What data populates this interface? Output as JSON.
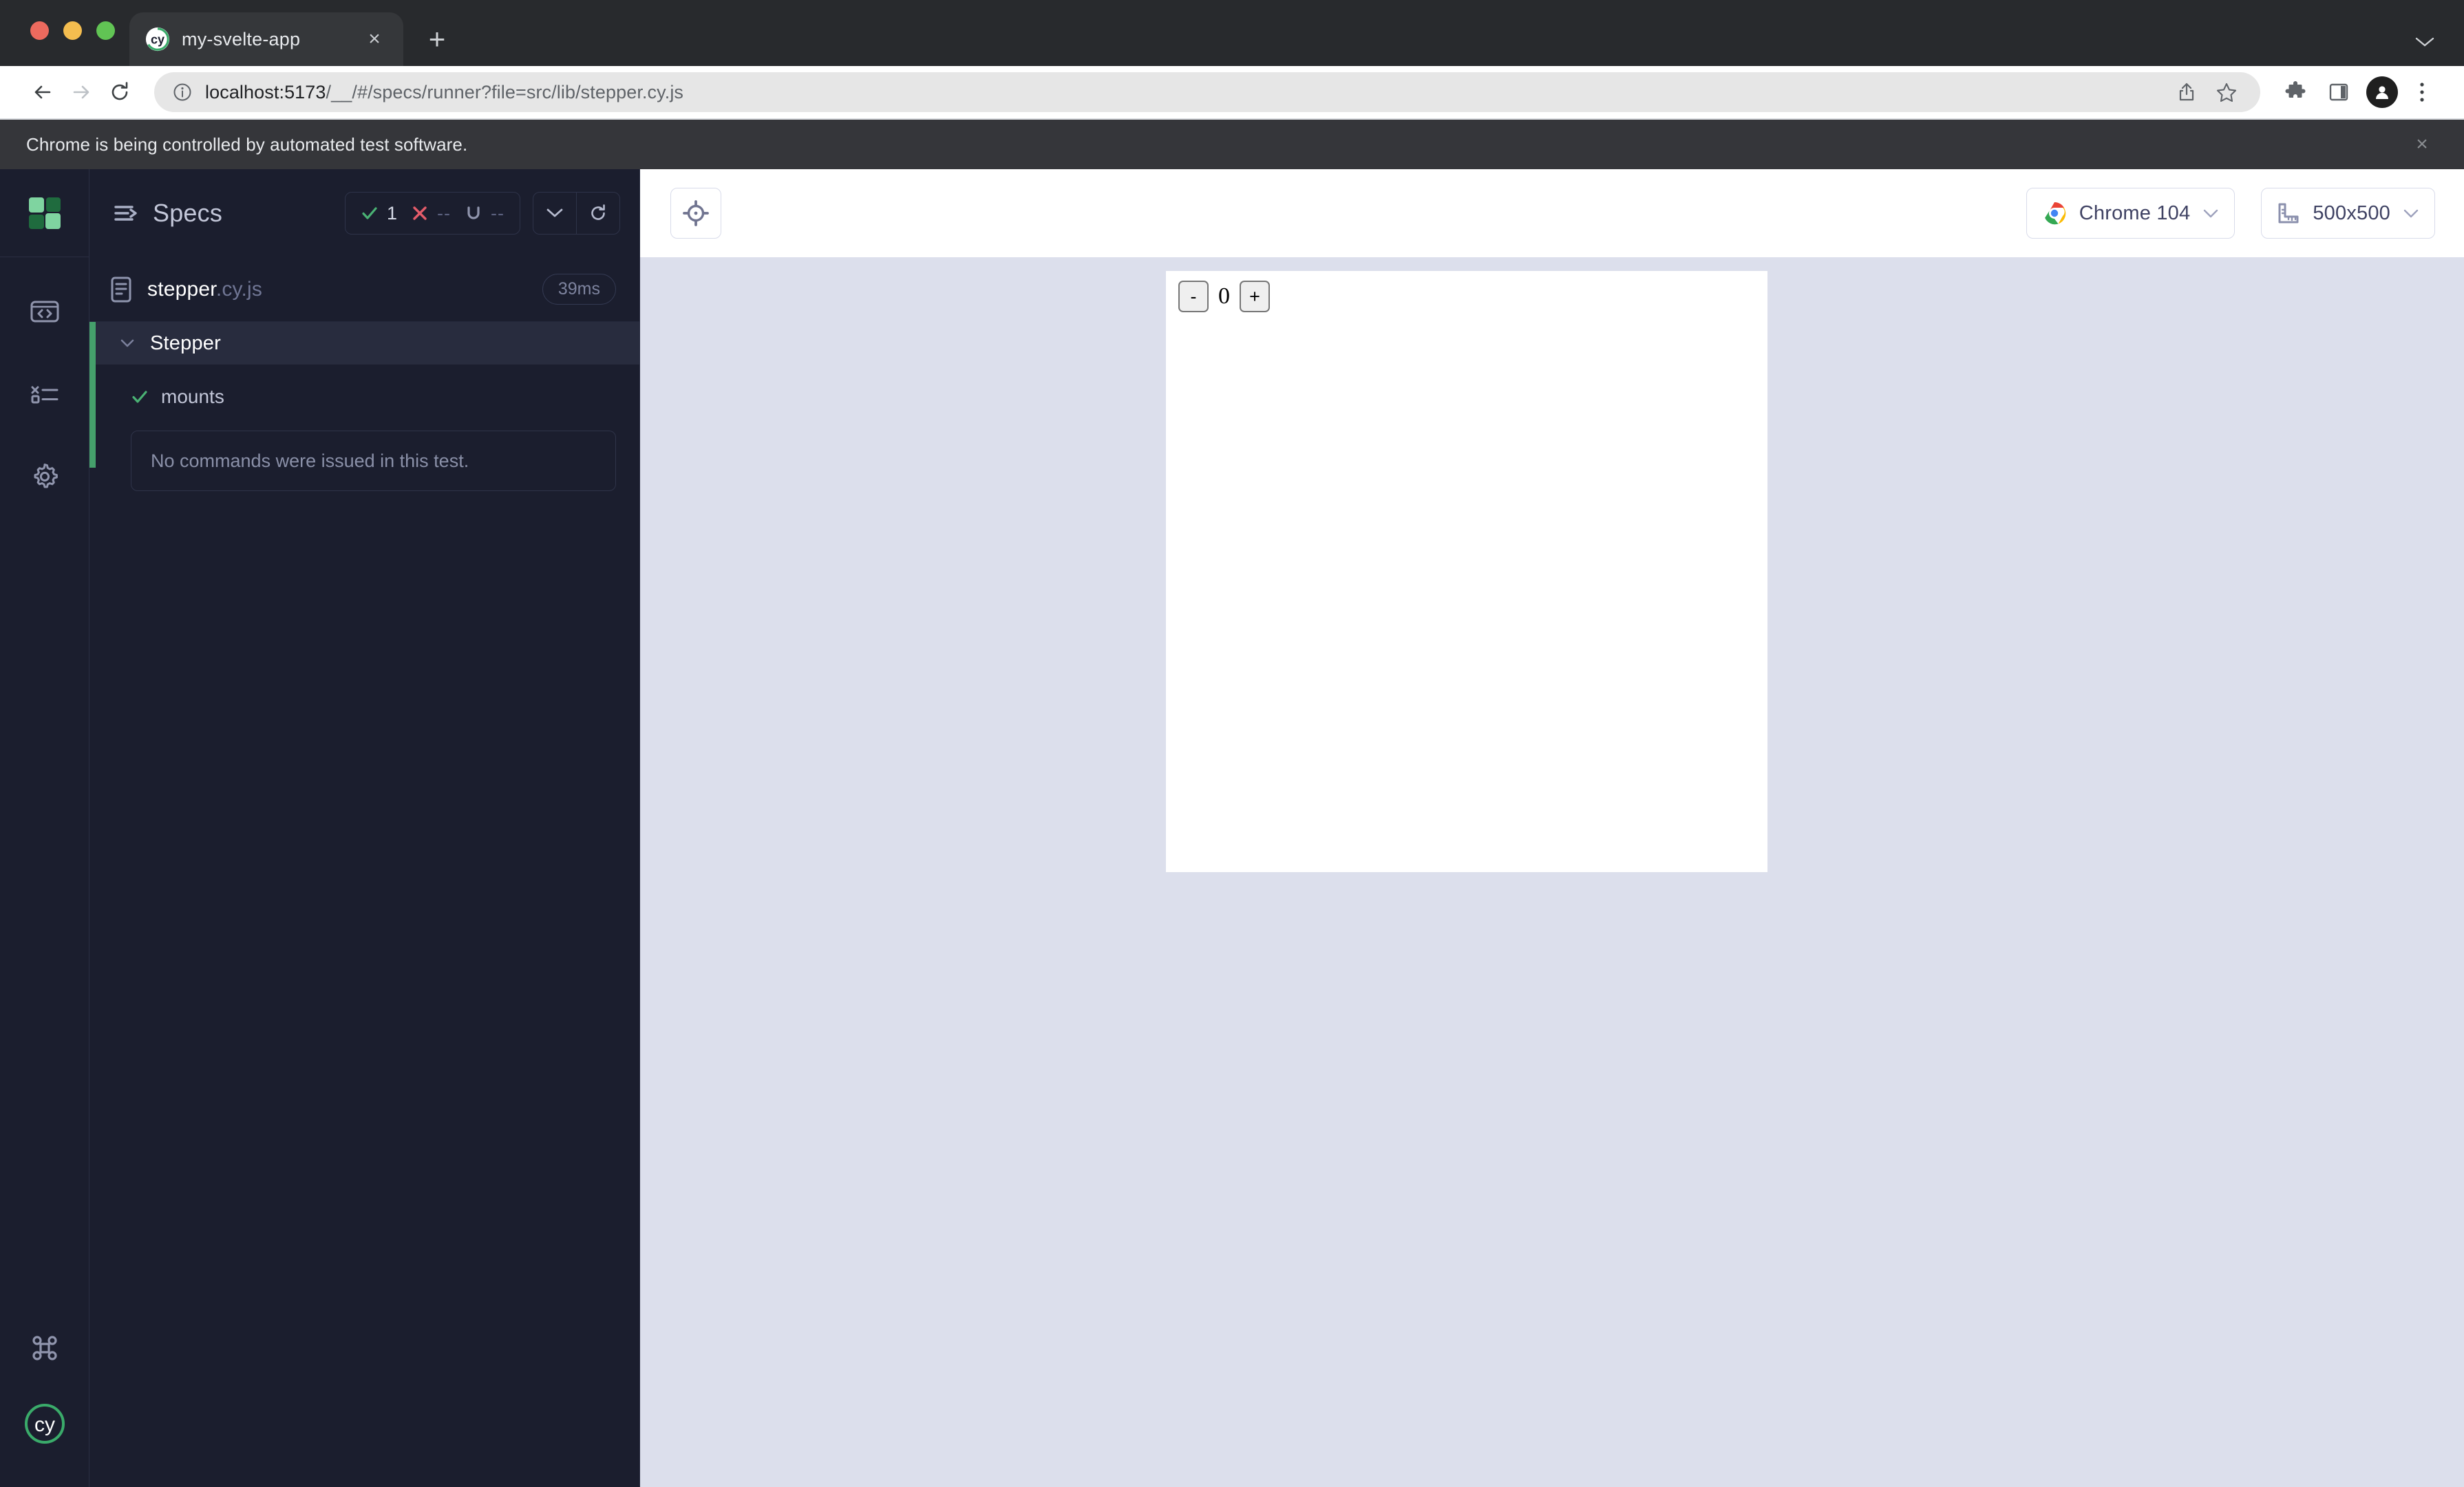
{
  "browser": {
    "tab": {
      "title": "my-svelte-app",
      "favicon": "cypress-cy-logo",
      "close_label": "×"
    },
    "new_tab_label": "+",
    "tab_list_chevron": "chevron-down-icon",
    "nav": {
      "back": "back-arrow-icon",
      "forward": "forward-arrow-icon",
      "reload": "reload-icon"
    },
    "omnibox": {
      "info_icon": "site-info-icon",
      "url_host": "localhost:5173",
      "url_path": "/__/#/specs/runner?file=src/lib/stepper.cy.js",
      "url_full": "localhost:5173/__/#/specs/runner?file=src/lib/stepper.cy.js",
      "share_icon": "share-icon",
      "bookmark_icon": "star-icon"
    },
    "toolbar_icons": [
      "extensions-puzzle-icon",
      "side-panel-icon",
      "profile-avatar",
      "three-dot-menu-icon"
    ],
    "infobar": {
      "message": "Chrome is being controlled by automated test software.",
      "close_label": "×"
    }
  },
  "rail": {
    "logo": "project-logo-squares",
    "items": [
      {
        "name": "specs",
        "icon": "code-window-icon"
      },
      {
        "name": "runs",
        "icon": "runs-list-icon"
      },
      {
        "name": "settings",
        "icon": "gear-icon"
      }
    ],
    "bottom": [
      {
        "name": "keyboard-shortcuts",
        "icon": "command-key-icon"
      },
      {
        "name": "cypress-logo",
        "icon": "cypress-cy-logo"
      }
    ]
  },
  "reporter": {
    "header": {
      "menu_icon": "collapse-sidebar-icon",
      "title": "Specs",
      "stats": [
        {
          "name": "passed",
          "icon": "check-icon",
          "value": "1",
          "color": "#4ab274"
        },
        {
          "name": "failed",
          "icon": "x-icon",
          "value": "--",
          "color": "#e45c6a"
        },
        {
          "name": "pending",
          "icon": "pending-circle-icon",
          "value": "--",
          "color": "#9095ad"
        }
      ],
      "controls": [
        {
          "name": "toggle-all",
          "icon": "chevron-down-icon"
        },
        {
          "name": "restart-tests",
          "icon": "restart-icon"
        }
      ]
    },
    "spec": {
      "icon": "spec-file-icon",
      "base_name": "stepper",
      "extension": ".cy.js",
      "duration": "39ms"
    },
    "tree": {
      "suite": {
        "name": "Stepper",
        "chevron": "chevron-down-icon",
        "state": "passed"
      },
      "tests": [
        {
          "name": "mounts",
          "status_icon": "check-icon",
          "status": "passed"
        }
      ],
      "commands_message": "No commands were issued in this test."
    }
  },
  "runner": {
    "playground": {
      "icon": "selector-playground-crosshair-icon"
    },
    "browser_selector": {
      "icon": "chrome-logo-icon",
      "label": "Chrome 104",
      "chevron": "chevron-down-icon"
    },
    "viewport_selector": {
      "icon": "ruler-icon",
      "label": "500x500",
      "chevron": "chevron-down-icon"
    },
    "component": {
      "name": "Stepper",
      "decrement_label": "-",
      "value": "0",
      "increment_label": "+"
    }
  },
  "colors": {
    "panel_dark": "#1b1e2e",
    "panel_row_active": "#282c3e",
    "accent_green": "#45a06b",
    "pass_green": "#4ab274",
    "fail_red": "#e45c6a",
    "preview_backdrop": "#dcdfec",
    "text_primary": "#ffffff",
    "text_muted": "#8a90a8"
  }
}
